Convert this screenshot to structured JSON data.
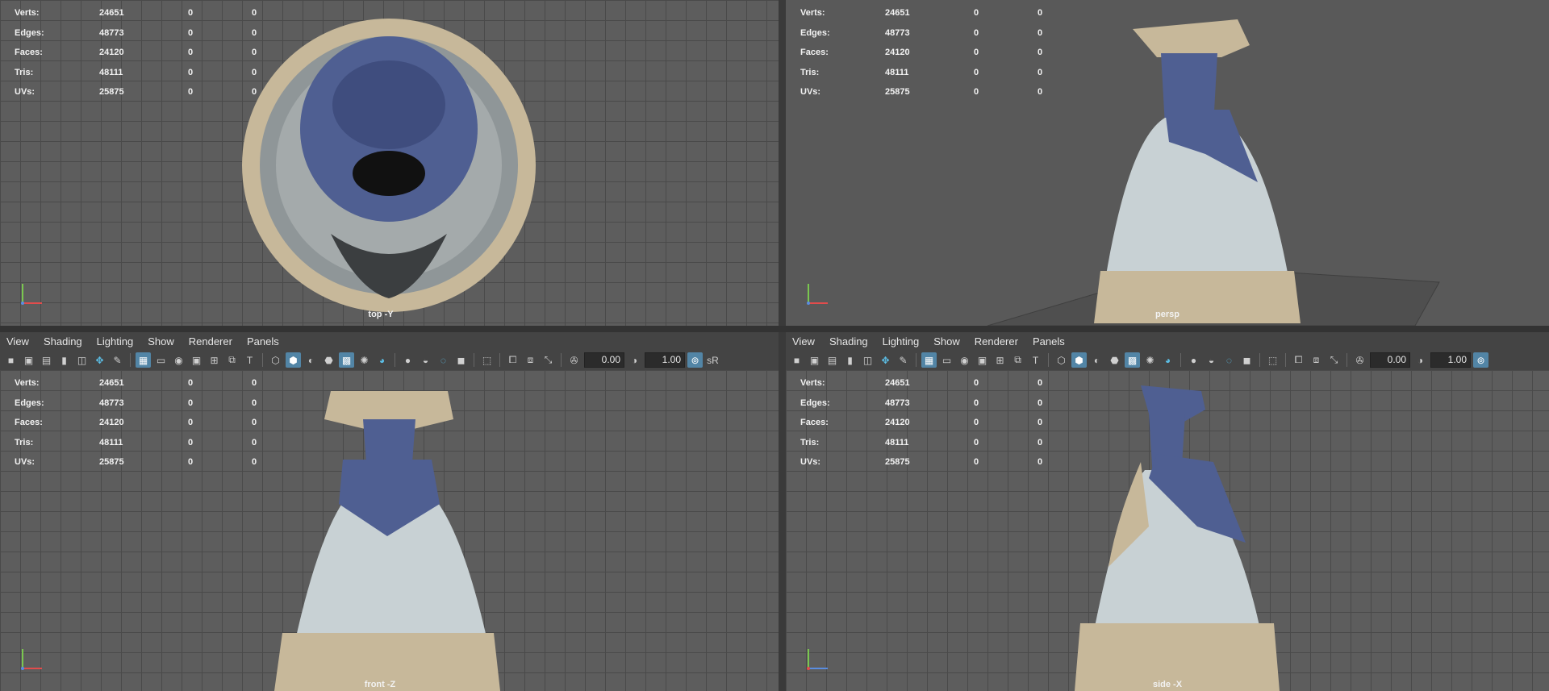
{
  "stats_labels": [
    "Verts:",
    "Edges:",
    "Faces:",
    "Tris:",
    "UVs:"
  ],
  "stats_values": [
    [
      "24651",
      "0",
      "0"
    ],
    [
      "48773",
      "0",
      "0"
    ],
    [
      "24120",
      "0",
      "0"
    ],
    [
      "48111",
      "0",
      "0"
    ],
    [
      "25875",
      "0",
      "0"
    ]
  ],
  "viewports": {
    "top": {
      "camera": "top -Y"
    },
    "persp": {
      "camera": "persp"
    },
    "front": {
      "camera": "front -Z"
    },
    "side": {
      "camera": "side -X"
    }
  },
  "menus": [
    "View",
    "Shading",
    "Lighting",
    "Show",
    "Renderer",
    "Panels"
  ],
  "toolbar": {
    "exposure": "0.00",
    "gamma": "1.00",
    "color_mgmt": "sR"
  },
  "icons": [
    "camera-icon",
    "grid-icon",
    "wireframe-icon",
    "smooth-shade-icon",
    "texture-icon",
    "light-icon",
    "isolate-icon",
    "xray-icon",
    "exposure-icon",
    "gamma-icon"
  ],
  "colors": {
    "viewport_bg": "#5d5d5d",
    "grid_line": "#4a4a4a",
    "toolbar_bg": "#444444",
    "active_button": "#5285a6",
    "dress_blue": "#4f5f92",
    "dress_light": "#c8d1d4",
    "lace": "#c7b89a"
  }
}
